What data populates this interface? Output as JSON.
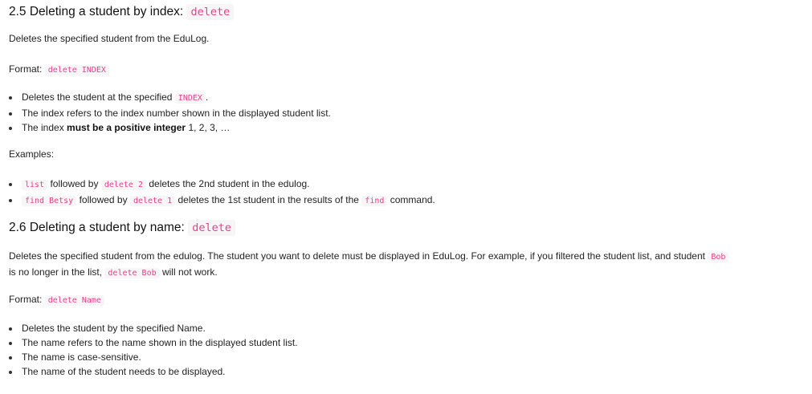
{
  "s25": {
    "title": "2.5 Deleting a student by index:",
    "title_code": "delete",
    "desc": "Deletes the specified student from the EduLog.",
    "format_label": "Format:",
    "format_code": "delete INDEX",
    "bullets": [
      {
        "pre": "Deletes the student at the specified",
        "code": "INDEX",
        "post": "."
      },
      {
        "text": "The index refers to the index number shown in the displayed student list."
      },
      {
        "pre": "The index",
        "bold": "must be a positive integer",
        "post": "1, 2, 3, …"
      }
    ],
    "examples_label": "Examples:",
    "examples": [
      {
        "c1": "list",
        "t1": "followed by",
        "c2": "delete 2",
        "t2": "deletes the 2nd student in the edulog."
      },
      {
        "c1": "find Betsy",
        "t1": "followed by",
        "c2": "delete 1",
        "t2": "deletes the 1st student in the results of the",
        "c3": "find",
        "t3": "command."
      }
    ]
  },
  "s26": {
    "title": "2.6 Deleting a student by name:",
    "title_code": "delete",
    "desc1": "Deletes the specified student from the edulog. The student you want to delete must be displayed in EduLog. For example, if you filtered the student list, and student",
    "desc_code1": "Bob",
    "desc2": "is no longer in the list,",
    "desc_code2": "delete Bob",
    "desc3": "will not work.",
    "format_label": "Format:",
    "format_code": "delete Name",
    "bullets": [
      "Deletes the student by the specified Name.",
      "The name refers to the name shown in the displayed student list.",
      "The name is case-sensitive.",
      "The name of the student needs to be displayed."
    ]
  }
}
